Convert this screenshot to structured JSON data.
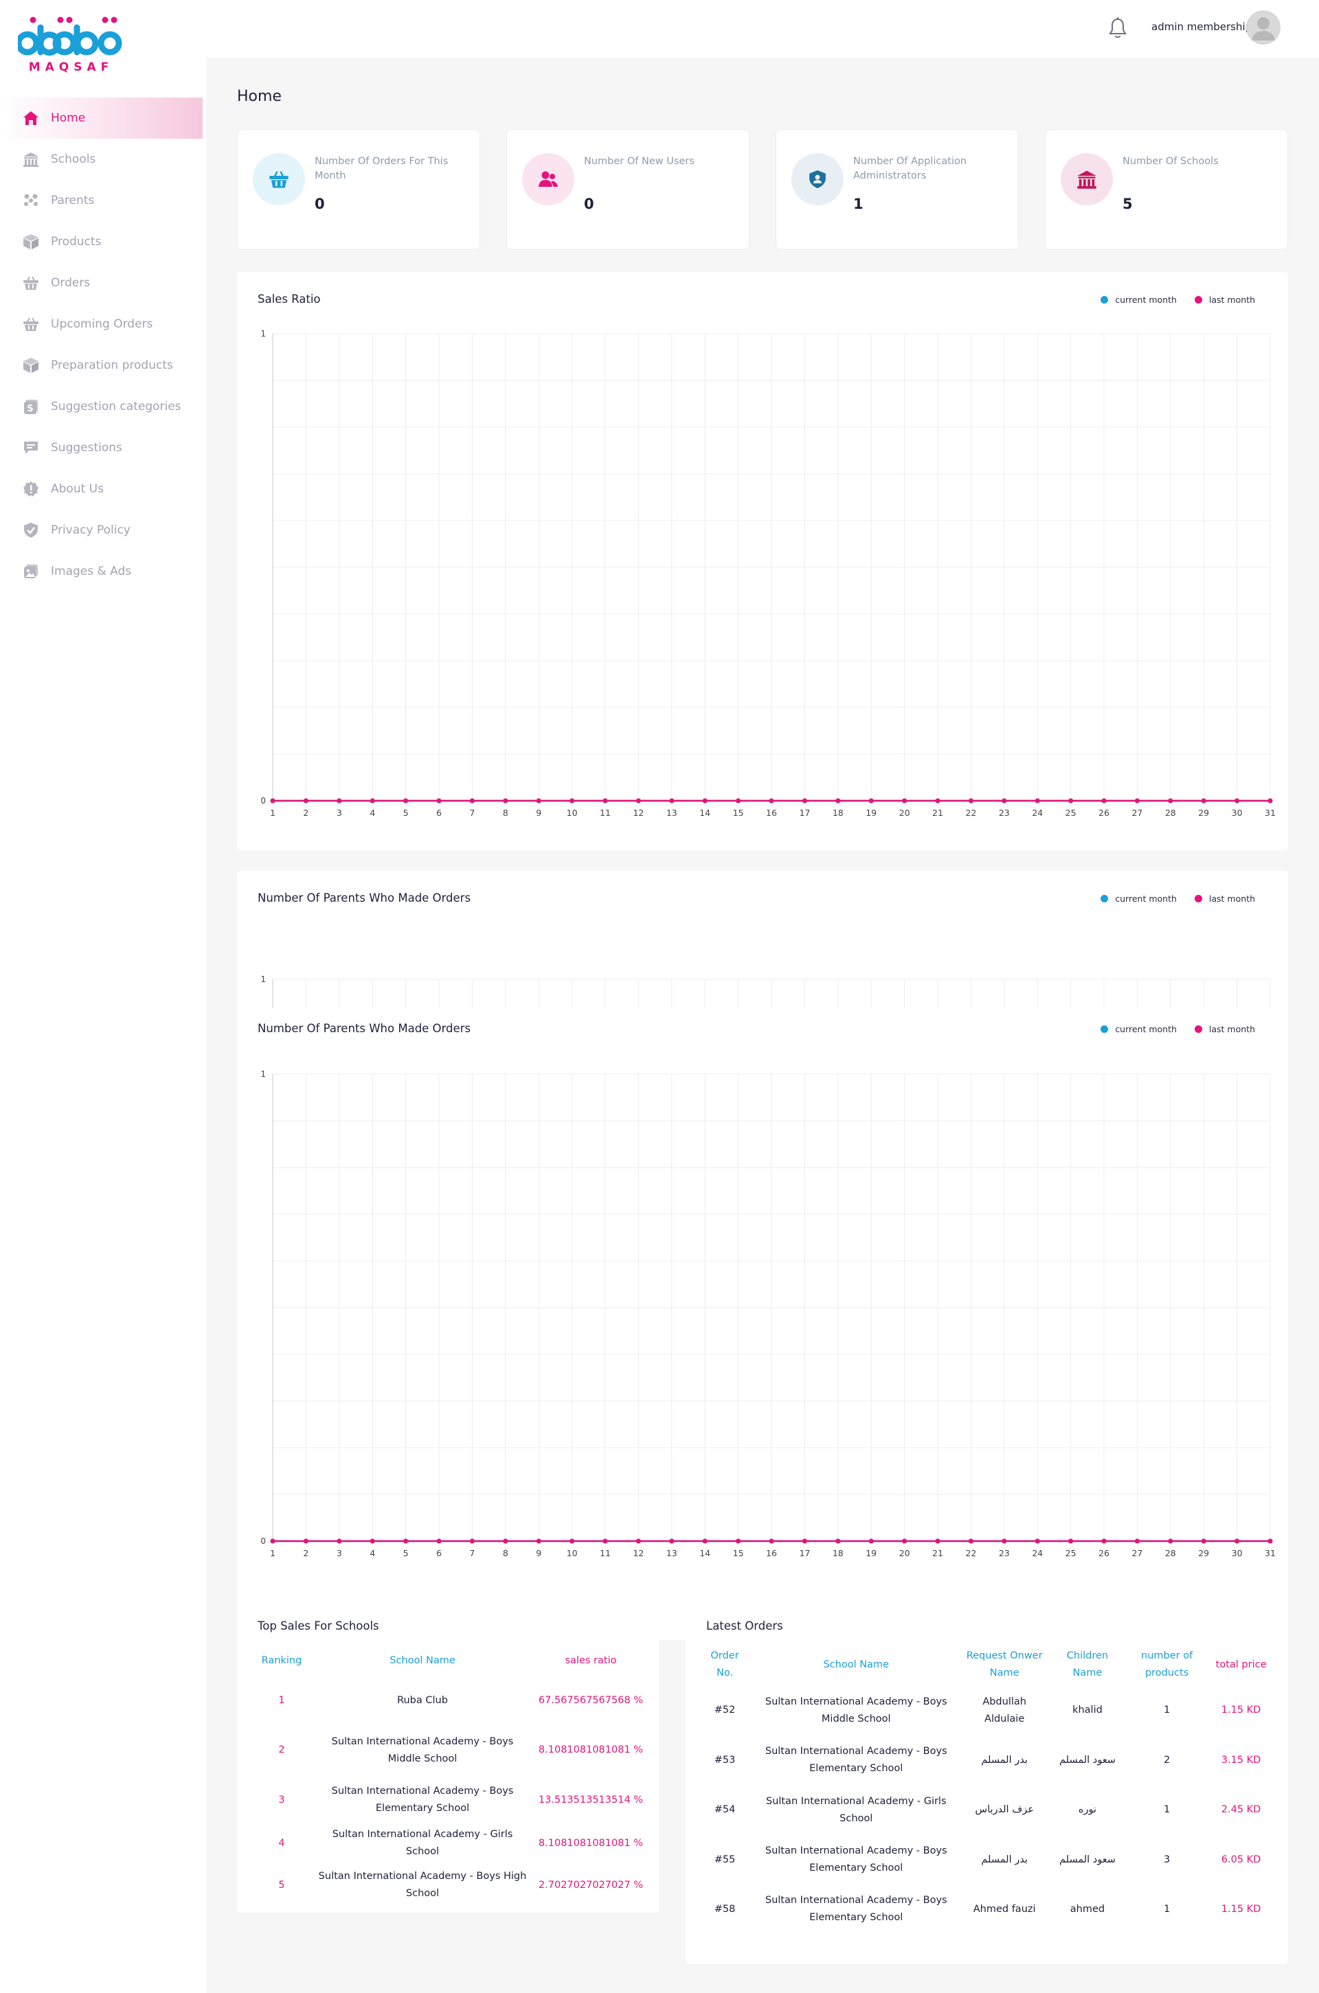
{
  "brand": {
    "name": "MAQSAF"
  },
  "sidebar": {
    "items": [
      {
        "label": "Home",
        "icon": "home-icon",
        "active": true
      },
      {
        "label": "Schools",
        "icon": "school-icon"
      },
      {
        "label": "Parents",
        "icon": "parents-icon"
      },
      {
        "label": "Products",
        "icon": "box-icon"
      },
      {
        "label": "Orders",
        "icon": "basket-icon"
      },
      {
        "label": "Upcoming Orders",
        "icon": "basket-icon"
      },
      {
        "label": "Preparation products",
        "icon": "box-icon"
      },
      {
        "label": "Suggestion categories",
        "icon": "category-icon"
      },
      {
        "label": "Suggestions",
        "icon": "chat-icon"
      },
      {
        "label": "About Us",
        "icon": "info-badge-icon"
      },
      {
        "label": "Privacy Policy",
        "icon": "shield-check-icon"
      },
      {
        "label": "Images & Ads",
        "icon": "image-icon"
      }
    ]
  },
  "header": {
    "user_name": "admin membership"
  },
  "page": {
    "title": "Home"
  },
  "stats": [
    {
      "label": "Number Of Orders For This Month",
      "value": "0",
      "icon": "basket-icon",
      "bg": "#e3f4fb",
      "color": "#1a9fd9"
    },
    {
      "label": "Number Of New Users",
      "value": "0",
      "icon": "users-icon",
      "bg": "#fbe3f0",
      "color": "#e3147c"
    },
    {
      "label": "Number Of Application Administrators",
      "value": "1",
      "icon": "admin-shield-icon",
      "bg": "#e7eff5",
      "color": "#1f6f9a"
    },
    {
      "label": "Number Of Schools",
      "value": "5",
      "icon": "school-icon",
      "bg": "#f7e2ec",
      "color": "#c2185b"
    }
  ],
  "colors": {
    "current_month": "#1a9fd9",
    "last_month": "#e3147c"
  },
  "chart_data": [
    {
      "type": "line",
      "title": "Sales Ratio",
      "x": [
        1,
        2,
        3,
        4,
        5,
        6,
        7,
        8,
        9,
        10,
        11,
        12,
        13,
        14,
        15,
        16,
        17,
        18,
        19,
        20,
        21,
        22,
        23,
        24,
        25,
        26,
        27,
        28,
        29,
        30,
        31
      ],
      "ylim": [
        0,
        1
      ],
      "yticks": [
        "0",
        "1"
      ],
      "grid": true,
      "legend_position": "top-right",
      "series": [
        {
          "name": "current month",
          "values": [
            0,
            0,
            0,
            0,
            0,
            0,
            0,
            0,
            0,
            0,
            0,
            0,
            0,
            0,
            0,
            0,
            0,
            0,
            0,
            0,
            0,
            0,
            0,
            0,
            0,
            0,
            0,
            0,
            0,
            0,
            0
          ]
        },
        {
          "name": "last month",
          "values": [
            0,
            0,
            0,
            0,
            0,
            0,
            0,
            0,
            0,
            0,
            0,
            0,
            0,
            0,
            0,
            0,
            0,
            0,
            0,
            0,
            0,
            0,
            0,
            0,
            0,
            0,
            0,
            0,
            0,
            0,
            0
          ]
        }
      ]
    },
    {
      "type": "line",
      "title": "Number Of Parents Who Made Orders",
      "ylim": [
        0,
        1
      ],
      "yticks": [
        "1"
      ],
      "grid": true,
      "legend_position": "top-right",
      "series": [
        {
          "name": "current month"
        },
        {
          "name": "last month"
        }
      ]
    },
    {
      "type": "line",
      "title": "Number Of Parents Who Made Orders",
      "x": [
        1,
        2,
        3,
        4,
        5,
        6,
        7,
        8,
        9,
        10,
        11,
        12,
        13,
        14,
        15,
        16,
        17,
        18,
        19,
        20,
        21,
        22,
        23,
        24,
        25,
        26,
        27,
        28,
        29,
        30,
        31
      ],
      "ylim": [
        0,
        1
      ],
      "yticks": [
        "0",
        "1"
      ],
      "grid": true,
      "legend_position": "top-right",
      "series": [
        {
          "name": "current month",
          "values": [
            0,
            0,
            0,
            0,
            0,
            0,
            0,
            0,
            0,
            0,
            0,
            0,
            0,
            0,
            0,
            0,
            0,
            0,
            0,
            0,
            0,
            0,
            0,
            0,
            0,
            0,
            0,
            0,
            0,
            0,
            0
          ]
        },
        {
          "name": "last month",
          "values": [
            0,
            0,
            0,
            0,
            0,
            0,
            0,
            0,
            0,
            0,
            0,
            0,
            0,
            0,
            0,
            0,
            0,
            0,
            0,
            0,
            0,
            0,
            0,
            0,
            0,
            0,
            0,
            0,
            0,
            0,
            0
          ]
        }
      ]
    }
  ],
  "top_sales": {
    "title": "Top Sales For Schools",
    "columns": [
      "Ranking",
      "School Name",
      "sales ratio"
    ],
    "rows": [
      [
        "1",
        "Ruba Club",
        "67.567567567568 %"
      ],
      [
        "2",
        "Sultan International Academy - Boys Middle School",
        "8.1081081081081 %"
      ],
      [
        "3",
        "Sultan International Academy - Boys Elementary School",
        "13.513513513514 %"
      ],
      [
        "4",
        "Sultan International Academy - Girls School",
        "8.1081081081081 %"
      ],
      [
        "5",
        "Sultan International Academy - Boys High School",
        "2.7027027027027 %"
      ]
    ]
  },
  "latest_orders": {
    "title": "Latest Orders",
    "columns": [
      "Order No.",
      "School Name",
      "Request Onwer Name",
      "Children Name",
      "number of products",
      "total price"
    ],
    "rows": [
      [
        "#52",
        "Sultan International Academy - Boys Middle School",
        "Abdullah Aldulaie",
        "khalid",
        "1",
        "1.15 KD"
      ],
      [
        "#53",
        "Sultan International Academy - Boys Elementary School",
        "بدر المسلم",
        "سعود المسلم",
        "2",
        "3.15 KD"
      ],
      [
        "#54",
        "Sultan International Academy - Girls School",
        "عزف الدرباس",
        "نوره",
        "1",
        "2.45 KD"
      ],
      [
        "#55",
        "Sultan International Academy - Boys Elementary School",
        "بدر المسلم",
        "سعود المسلم",
        "3",
        "6.05 KD"
      ],
      [
        "#58",
        "Sultan International Academy - Boys Elementary School",
        "Ahmed fauzi",
        "ahmed",
        "1",
        "1.15 KD"
      ]
    ]
  }
}
